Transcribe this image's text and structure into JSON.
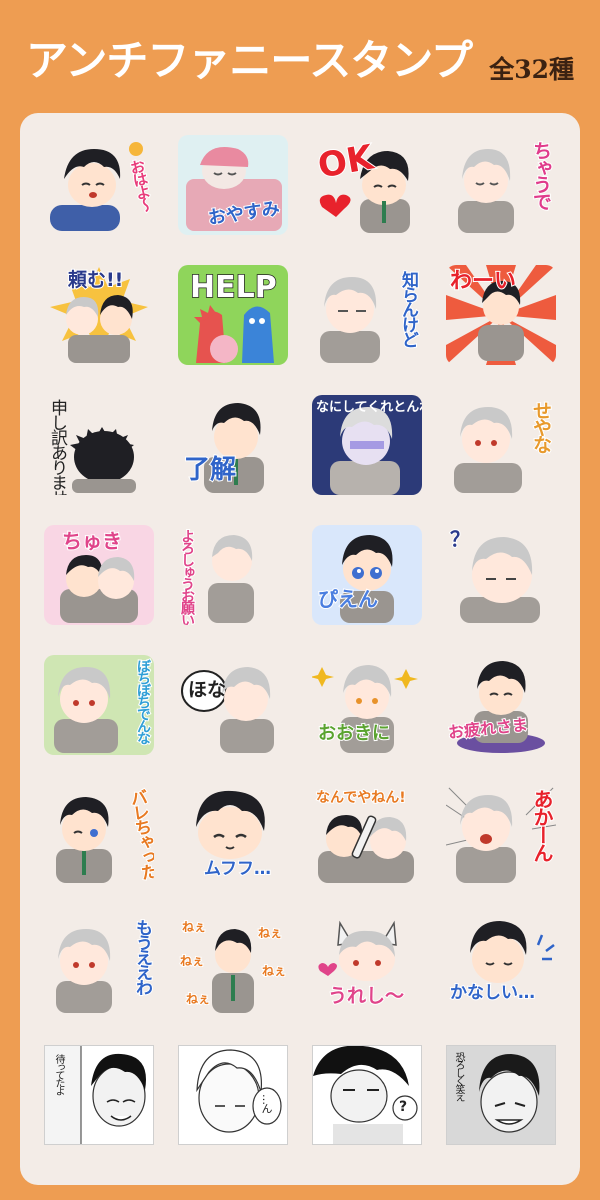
{
  "header": {
    "title": "アンチファニースタンプ",
    "count": "全32種"
  },
  "stickers": [
    {
      "label": "おはよ〜",
      "color": "#e83d7b"
    },
    {
      "label": "おやすみ",
      "color": "#2f64c9"
    },
    {
      "label": "OK",
      "color": "#e8222c"
    },
    {
      "label": "ちゃうで",
      "color": "#e03b8b"
    },
    {
      "label": "頼む!!",
      "color": "#2a3a8c"
    },
    {
      "label": "HELP",
      "color": "#ffffff"
    },
    {
      "label": "知らんけど",
      "color": "#2f64c9"
    },
    {
      "label": "わーい",
      "color": "#e8222c"
    },
    {
      "label": "申し訳ありません",
      "color": "#222222"
    },
    {
      "label": "了解",
      "color": "#2f64c9"
    },
    {
      "label": "なにしてくれとんねん",
      "color": "#ffffff"
    },
    {
      "label": "せやな",
      "color": "#e89a2d"
    },
    {
      "label": "ちゅき",
      "color": "#e0448a"
    },
    {
      "label": "よろしゅうお願いします!",
      "color": "#e0448a"
    },
    {
      "label": "ぴえん",
      "color": "#4a7ee0"
    },
    {
      "label": "？",
      "color": "#2a3a8c"
    },
    {
      "label": "ぼちぼちでんな",
      "color": "#2f9fd6"
    },
    {
      "label": "ほな",
      "color": "#222222"
    },
    {
      "label": "おおきに",
      "color": "#5aa32f"
    },
    {
      "label": "お疲れさま",
      "color": "#e0448a"
    },
    {
      "label": "バレちゃった",
      "color": "#e87a22"
    },
    {
      "label": "ムフフ…",
      "color": "#2f64c9"
    },
    {
      "label": "なんでやねん!",
      "color": "#e87a22"
    },
    {
      "label": "あかーん",
      "color": "#e8222c"
    },
    {
      "label": "もうええわ",
      "color": "#2f64c9"
    },
    {
      "label": "ねぇ",
      "color": "#e87a22"
    },
    {
      "label": "うれし〜",
      "color": "#e0448a"
    },
    {
      "label": "かなしい…",
      "color": "#2f64c9"
    },
    {
      "label": "待ってたよ",
      "color": "#222222"
    },
    {
      "label": "…ん",
      "color": "#222222"
    },
    {
      "label": "?",
      "color": "#222222"
    },
    {
      "label": "恐ろしく笑え",
      "color": "#222222"
    }
  ]
}
